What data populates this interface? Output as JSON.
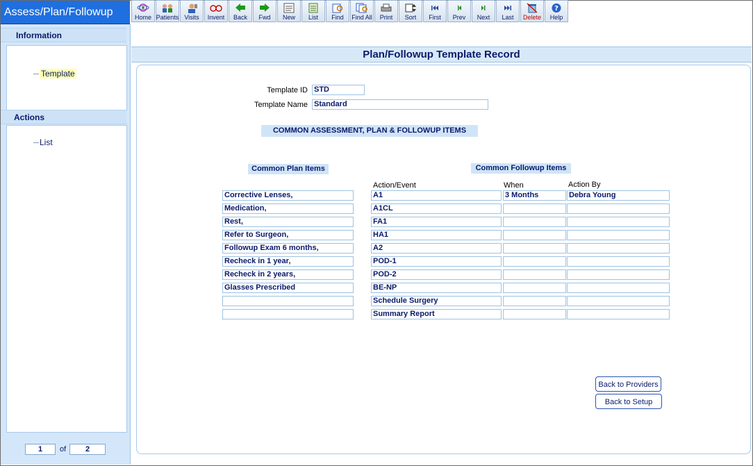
{
  "app": {
    "title": "Assess/Plan/Followup"
  },
  "sidebar": {
    "information_label": "Information",
    "template_link": "Template",
    "actions_label": "Actions",
    "list_link": "List",
    "pager": {
      "current": "1",
      "of_label": "of",
      "total": "2"
    }
  },
  "toolbar": {
    "items": [
      {
        "label": "Home",
        "icon": "home-icon"
      },
      {
        "label": "Patients",
        "icon": "patients-icon"
      },
      {
        "label": "Visits",
        "icon": "visits-icon"
      },
      {
        "label": "Invent",
        "icon": "glasses-icon"
      },
      {
        "label": "Back",
        "icon": "arrow-left-icon"
      },
      {
        "label": "Fwd",
        "icon": "arrow-right-icon"
      },
      {
        "label": "New",
        "icon": "new-icon"
      },
      {
        "label": "List",
        "icon": "list-icon"
      },
      {
        "label": "Find",
        "icon": "find-icon"
      },
      {
        "label": "Find All",
        "icon": "find-all-icon"
      },
      {
        "label": "Print",
        "icon": "printer-icon"
      },
      {
        "label": "Sort",
        "icon": "sort-icon"
      },
      {
        "label": "First",
        "icon": "first-icon"
      },
      {
        "label": "Prev",
        "icon": "prev-icon"
      },
      {
        "label": "Next",
        "icon": "next-icon"
      },
      {
        "label": "Last",
        "icon": "last-icon"
      },
      {
        "label": "Delete",
        "icon": "delete-icon"
      },
      {
        "label": "Help",
        "icon": "help-icon"
      }
    ]
  },
  "record": {
    "title": "Plan/Followup Template Record",
    "template_id_label": "Template ID",
    "template_id": "STD",
    "template_name_label": "Template Name",
    "template_name": "Standard",
    "section_banner": "COMMON ASSESSMENT, PLAN & FOLLOWUP  ITEMS",
    "plan_header": "Common Plan Items",
    "followup_header": "Common Followup Items",
    "col_action": "Action/Event",
    "col_when": "When",
    "col_by": "Action By",
    "plan_items": [
      "Corrective Lenses,",
      "Medication,",
      "Rest,",
      "Refer to Surgeon,",
      "Followup Exam 6 months,",
      "Recheck in 1 year,",
      "Recheck in 2 years,",
      "Glasses Prescribed",
      "",
      ""
    ],
    "followup_rows": [
      {
        "action": "A1",
        "when": "3 Months",
        "by": "Debra Young"
      },
      {
        "action": "A1CL",
        "when": "",
        "by": ""
      },
      {
        "action": "FA1",
        "when": "",
        "by": ""
      },
      {
        "action": "HA1",
        "when": "",
        "by": ""
      },
      {
        "action": "A2",
        "when": "",
        "by": ""
      },
      {
        "action": "POD-1",
        "when": "",
        "by": ""
      },
      {
        "action": "POD-2",
        "when": "",
        "by": ""
      },
      {
        "action": "BE-NP",
        "when": "",
        "by": ""
      },
      {
        "action": "Schedule Surgery",
        "when": "",
        "by": ""
      },
      {
        "action": "Summary Report",
        "when": "",
        "by": ""
      }
    ],
    "back_to_providers": "Back to Providers",
    "back_to_setup": "Back to Setup"
  }
}
